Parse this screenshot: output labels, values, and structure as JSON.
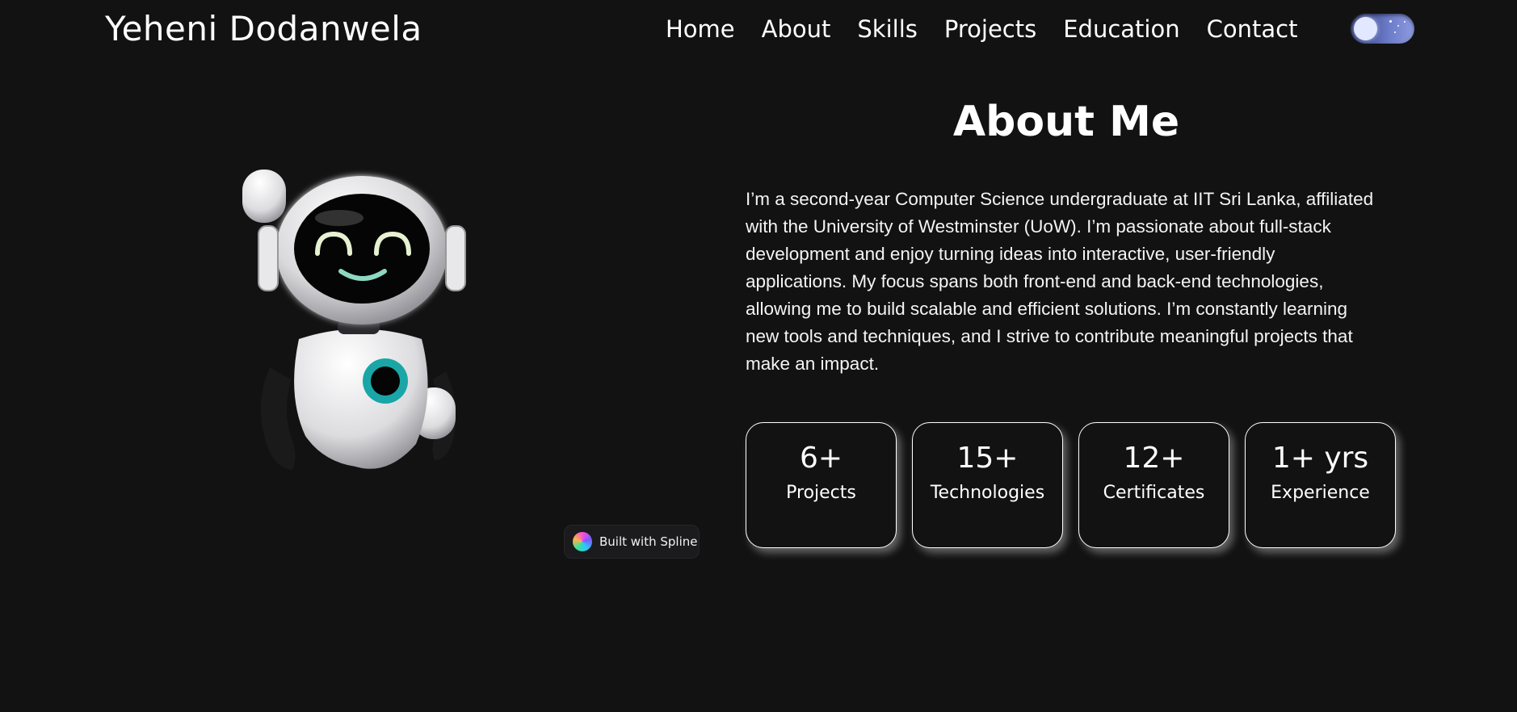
{
  "header": {
    "brand": "Yeheni Dodanwela",
    "nav": [
      "Home",
      "About",
      "Skills",
      "Projects",
      "Education",
      "Contact"
    ],
    "theme_toggle": {
      "state": "dark",
      "icon": "moon-stars-icon"
    }
  },
  "about": {
    "title": "About Me",
    "description": "I’m a second-year Computer Science undergraduate at IIT Sri Lanka, affiliated with the University of Westminster (UoW). I’m passionate about full-stack development and enjoy turning ideas into interactive, user-friendly applications. My focus spans both front-end and back-end technologies, allowing me to build scalable and efficient solutions. I’m constantly learning new tools and techniques, and I strive to contribute meaningful projects that make an impact.",
    "stats": [
      {
        "value": "6+",
        "label": "Projects"
      },
      {
        "value": "15+",
        "label": "Technologies"
      },
      {
        "value": "12+",
        "label": "Certificates"
      },
      {
        "value": "1+ yrs",
        "label": "Experience"
      }
    ]
  },
  "spline_badge": {
    "label": "Built with Spline",
    "icon": "spline-logo-icon"
  },
  "colors": {
    "background": "#121212",
    "text": "#ffffff",
    "robot_accent": "#1aa6a6",
    "toggle_gradient_start": "#2b3a7d",
    "toggle_gradient_end": "#8d9be0"
  }
}
